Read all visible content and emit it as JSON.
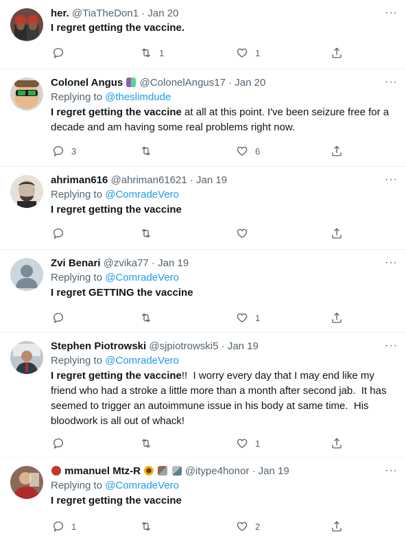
{
  "tweets": [
    {
      "name": "her.",
      "handle": "@TiaTheDon1",
      "date": "Jan 20",
      "replying_label": "",
      "replying_to": "",
      "text_bold": "I regret getting the vaccine.",
      "text_rest": "",
      "replies": "",
      "retweets": "1",
      "likes": "1"
    },
    {
      "name": "Colonel Angus",
      "handle": "@ColonelAngus17",
      "date": "Jan 20",
      "replying_label": "Replying to",
      "replying_to": "@theslimdude",
      "text_bold": "I regret getting the vaccine",
      "text_rest": " at all at this point. I've been seizure free for a decade and am having some real problems right now.",
      "replies": "3",
      "retweets": "",
      "likes": "6"
    },
    {
      "name": "ahriman616",
      "handle": "@ahriman61621",
      "date": "Jan 19",
      "replying_label": "Replying to",
      "replying_to": "@ComradeVero",
      "text_bold": "I regret getting the vaccine",
      "text_rest": "",
      "replies": "",
      "retweets": "",
      "likes": ""
    },
    {
      "name": "Zvi Benari",
      "handle": "@zvika77",
      "date": "Jan 19",
      "replying_label": "Replying to",
      "replying_to": "@ComradeVero",
      "text_bold": "I regret GETTING the vaccine",
      "text_rest": "",
      "replies": "",
      "retweets": "",
      "likes": "1"
    },
    {
      "name": "Stephen Piotrowski",
      "handle": "@sjpiotrowski5",
      "date": "Jan 19",
      "replying_label": "Replying to",
      "replying_to": "@ComradeVero",
      "text_bold": "I regret getting the vaccine",
      "text_rest": "!!  I worry every day that I may end like my friend who had a stroke a little more than a month after second jab.  It has seemed to trigger an autoimmune issue in his body at same time.  His bloodwork is all out of whack!",
      "replies": "",
      "retweets": "",
      "likes": "1"
    },
    {
      "name": "ὑ3mmanuel Mtz-R",
      "name_display": "mmanuel Mtz-R",
      "handle": "@itype4honor",
      "date": "Jan 19",
      "replying_label": "Replying to",
      "replying_to": "@ComradeVero",
      "text_bold": "I regret getting the vaccine",
      "text_rest": "",
      "replies": "1",
      "retweets": "",
      "likes": "2"
    }
  ],
  "separator": "·",
  "more_label": "···",
  "colors": {
    "link": "#1d9bf0",
    "muted": "#536471",
    "text": "#0f1419",
    "border": "#eff3f4"
  }
}
